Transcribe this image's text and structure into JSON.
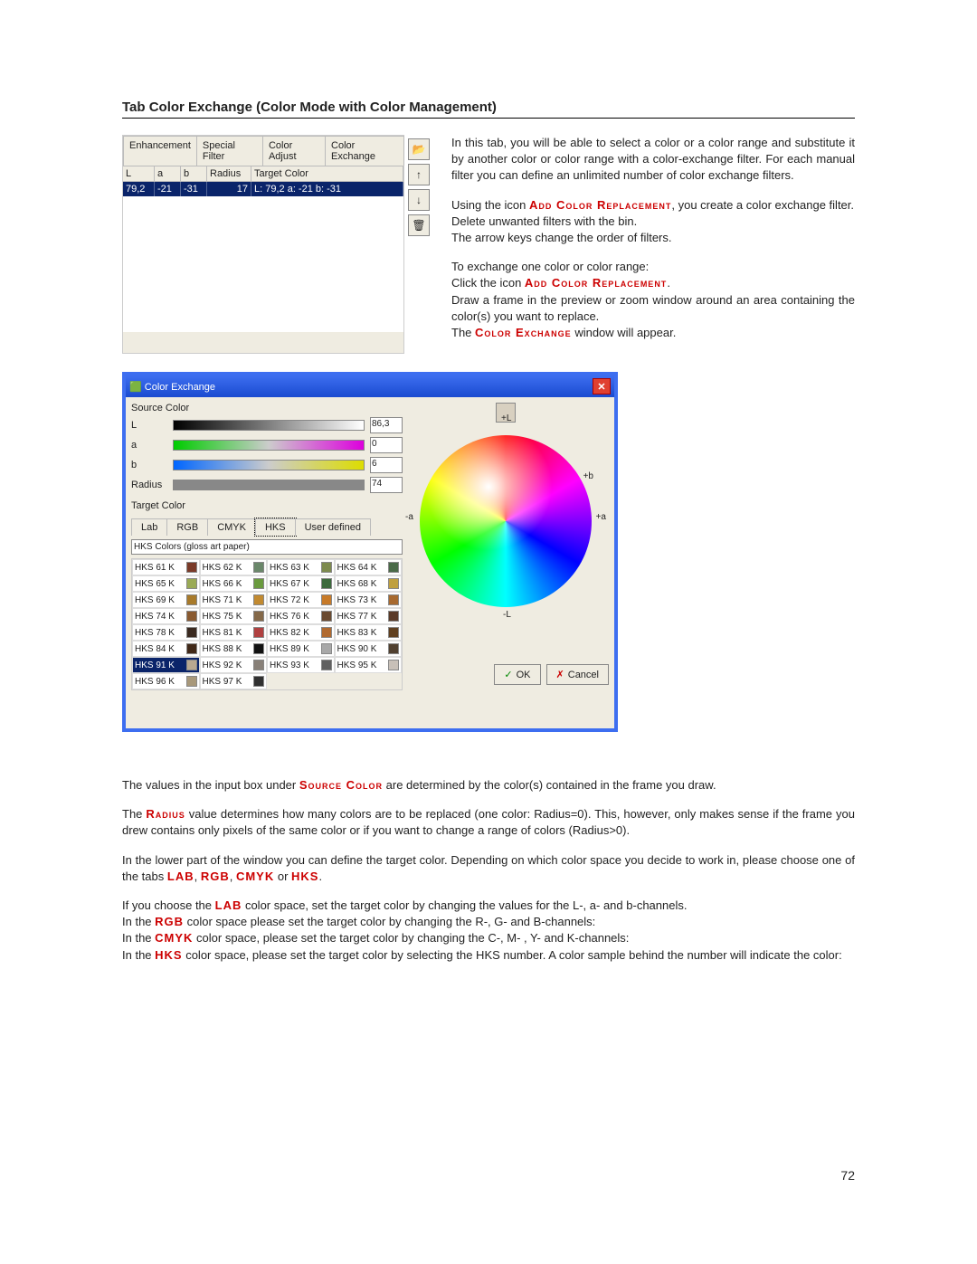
{
  "heading": "Tab Color Exchange (Color Mode with Color Management)",
  "tabs": {
    "t0": "Enhancement",
    "t1": "Special Filter",
    "t2": "Color Adjust",
    "t3": "Color Exchange"
  },
  "cols": {
    "L": "L",
    "a": "a",
    "b": "b",
    "Radius": "Radius",
    "Target": "Target Color"
  },
  "row": {
    "L": "79,2",
    "a": "-21",
    "b": "-31",
    "Radius": "17",
    "Target": "L: 79,2 a: -21 b: -31"
  },
  "side": {
    "open": "📂",
    "up": "↑",
    "down": "↓",
    "del": "🗑"
  },
  "p1": "In this tab, you will be able to select a color or a color range and substitute it by another color or color range with a color-exchange filter. For each manual filter you can define an unlimited number of color exchange filters.",
  "p2a": "Using the icon ",
  "add": "Add Color Replacement",
  "p2b": ", you create a color exchange filter.",
  "p2c": "Delete unwanted filters with the bin.",
  "p2d": "The arrow keys change the order of filters.",
  "p3a": "To exchange one color or color range:",
  "p3b": "Click the icon ",
  "p3c": "Draw a frame in the preview or zoom window around an area containing the color(s) you want to replace.",
  "p3d_a": "The ",
  "ce_sc": "Color Exchange",
  "p3d_b": " window will appear.",
  "ce": {
    "title": "Color Exchange",
    "src": "Source Color",
    "tc": "Target Color",
    "L": "L",
    "a": "a",
    "b": "b",
    "Radius": "Radius",
    "vL": "86,3",
    "va": "0",
    "vb": "6",
    "vr": "74",
    "tabs": {
      "lab": "Lab",
      "rgb": "RGB",
      "cmyk": "CMYK",
      "hks": "HKS",
      "ud": "User defined"
    },
    "hksset": "HKS Colors (gloss art paper)",
    "plusL": "+L",
    "minusL": "-L",
    "plusa": "+a",
    "minusa": "-a",
    "plusb": "+b",
    "ok": "OK",
    "cancel": "Cancel",
    "check": "✓",
    "cross": "✗"
  },
  "hks": [
    {
      "n": "HKS 61 K",
      "c": "#7a3a28"
    },
    {
      "n": "HKS 62 K",
      "c": "#6a876a"
    },
    {
      "n": "HKS 63 K",
      "c": "#7d8a4e"
    },
    {
      "n": "HKS 64 K",
      "c": "#4a6a48"
    },
    {
      "n": "HKS 65 K",
      "c": "#9aaa55"
    },
    {
      "n": "HKS 66 K",
      "c": "#6a9a3e"
    },
    {
      "n": "HKS 67 K",
      "c": "#3c6a3c"
    },
    {
      "n": "HKS 68 K",
      "c": "#bfa040"
    },
    {
      "n": "HKS 69 K",
      "c": "#a87a2a"
    },
    {
      "n": "HKS 71 K",
      "c": "#c28a30"
    },
    {
      "n": "HKS 72 K",
      "c": "#c77a28"
    },
    {
      "n": "HKS 73 K",
      "c": "#a86a30"
    },
    {
      "n": "HKS 74 K",
      "c": "#8a5a30"
    },
    {
      "n": "HKS 75 K",
      "c": "#846848"
    },
    {
      "n": "HKS 76 K",
      "c": "#6a4a30"
    },
    {
      "n": "HKS 77 K",
      "c": "#5a3a28"
    },
    {
      "n": "HKS 78 K",
      "c": "#3a2a20"
    },
    {
      "n": "HKS 81 K",
      "c": "#b04040"
    },
    {
      "n": "HKS 82 K",
      "c": "#b06a30"
    },
    {
      "n": "HKS 83 K",
      "c": "#604020"
    },
    {
      "n": "HKS 84 K",
      "c": "#402818"
    },
    {
      "n": "HKS 88 K",
      "c": "#111111"
    },
    {
      "n": "HKS 89 K",
      "c": "#a8a8a8"
    },
    {
      "n": "HKS 90 K",
      "c": "#504030"
    },
    {
      "n": "HKS 91 K",
      "c": "#b8a890",
      "sel": true
    },
    {
      "n": "HKS 92 K",
      "c": "#888078"
    },
    {
      "n": "HKS 93 K",
      "c": "#606060"
    },
    {
      "n": "HKS 95 K",
      "c": "#c8c0b8"
    },
    {
      "n": "HKS 96 K",
      "c": "#a8987a"
    },
    {
      "n": "HKS 97 K",
      "c": "#303030"
    }
  ],
  "p4a": "The values in the input box under ",
  "srccol": "Source Color",
  "p4b": " are determined by the color(s) contained in the frame you draw.",
  "p5a": "The ",
  "radius": "Radius",
  "p5b": " value determines how many colors are to be replaced (one color: Radius=0). This, however, only makes sense if the frame you drew contains only pixels of the same color or if you want to change a range of colors (Radius>0).",
  "p6a": "In the lower part of the window you can define the target color. Depending on which color space you decide to work in, please choose one of the tabs ",
  "lab": "LAB",
  "rgb": "RGB",
  "cmyk": "CMYK",
  "hkss": "HKS",
  "or": " or ",
  "comma": ", ",
  "dot": ".",
  "p7a": "If you choose the ",
  "p7b": " color space, set the target color by changing the values for the L-, a- and b-channels.",
  "p8a": "In the ",
  "p8b": " color space please set the target color by changing the R-, G- and B-channels:",
  "p9b": " color space, please set the target color by changing the C-, M- , Y- and K-channels:",
  "p10b": " color space, please set the target color by selecting the HKS number. A color sample behind the number will indicate the color:",
  "pagenum": "72"
}
